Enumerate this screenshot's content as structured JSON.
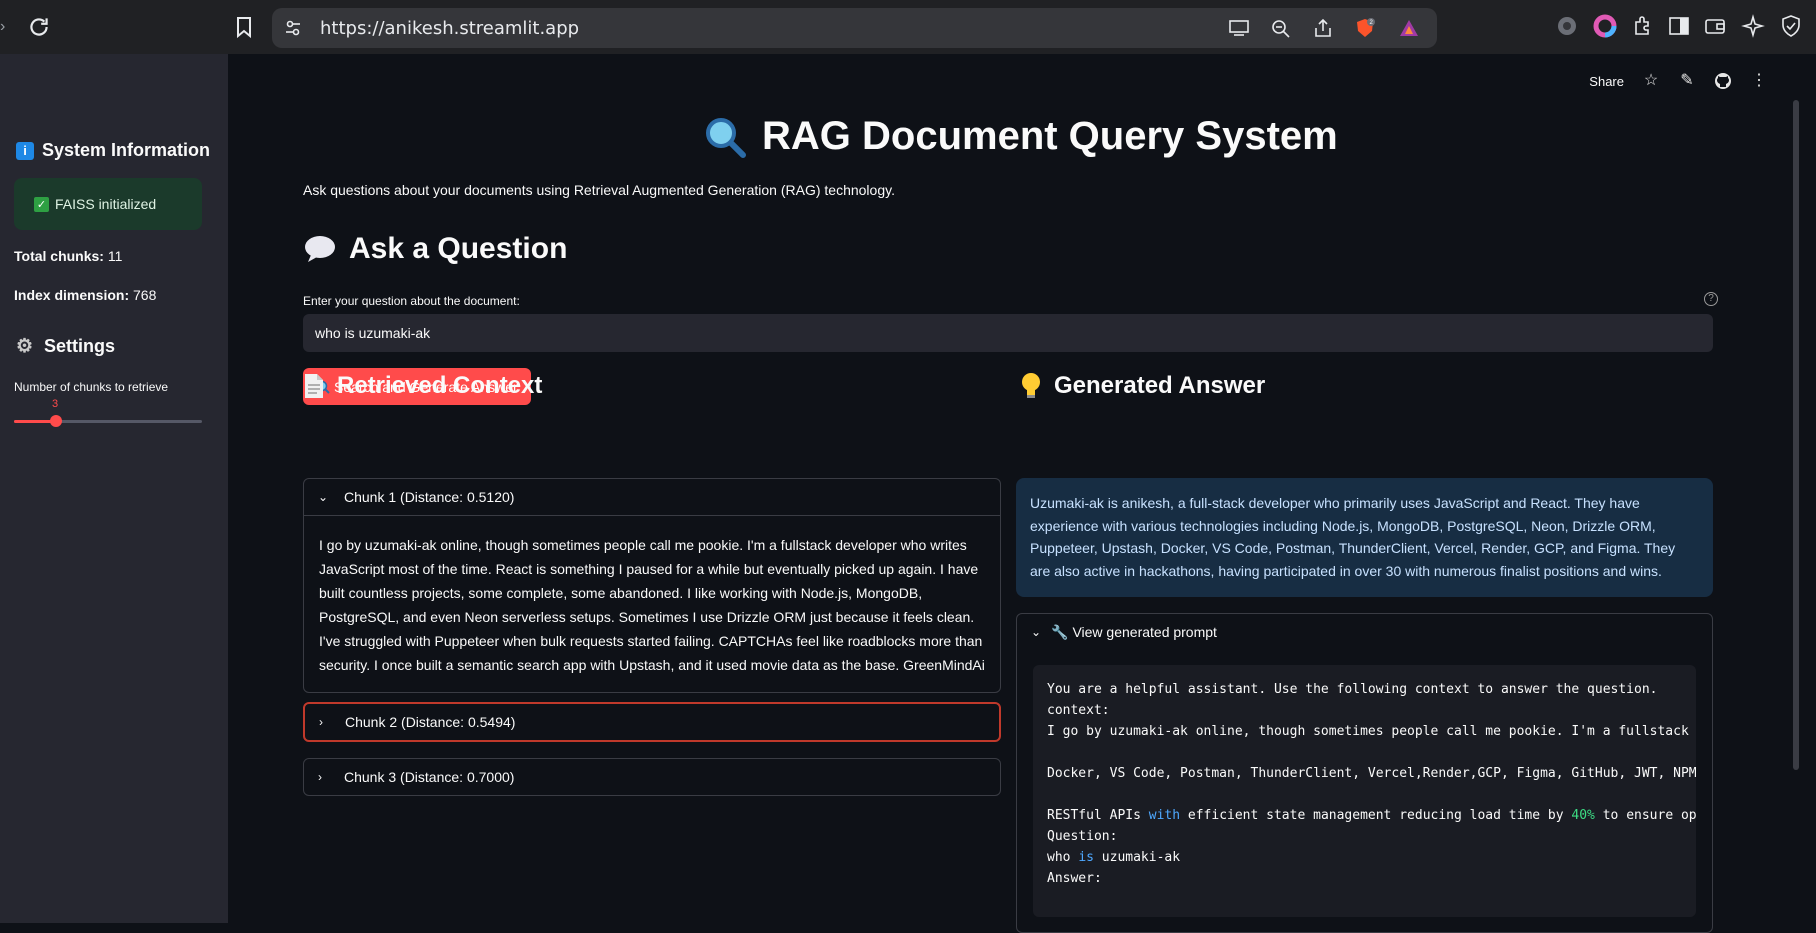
{
  "browser": {
    "url": "https://anikesh.streamlit.app",
    "brave_badge": "2"
  },
  "sidebar": {
    "system_info_title": "System Information",
    "status_text": "FAISS initialized",
    "total_chunks_label": "Total chunks:",
    "total_chunks_value": "11",
    "index_dim_label": "Index dimension:",
    "index_dim_value": "768",
    "settings_title": "Settings",
    "slider_label": "Number of chunks to retrieve",
    "slider_value": "3",
    "slider_fraction": 0.2222,
    "success_color": "#2ea043",
    "accent_color": "#ff4b4b"
  },
  "toolbar": {
    "share_label": "Share"
  },
  "header": {
    "title": "RAG Document Query System",
    "subtitle": "Ask questions about your documents using Retrieval Augmented Generation (RAG) technology."
  },
  "question": {
    "heading": "Ask a Question",
    "input_label": "Enter your question about the document:",
    "input_value": "who is uzumaki-ak",
    "button_label": "Search and Generate Answer"
  },
  "context": {
    "heading": "Retrieved Context",
    "chunks": [
      {
        "label": "Chunk 1 (Distance: 0.5120)",
        "text": "I go by uzumaki-ak online, though sometimes people call me pookie. I'm a fullstack developer who writes JavaScript most of the time. React is something I paused for a while but eventually picked up again. I have built countless projects, some complete, some abandoned. I like working with Node.js, MongoDB, PostgreSQL, and even Neon serverless setups. Sometimes I use Drizzle ORM just because it feels clean. I've struggled with Puppeteer when bulk requests started failing. CAPTCHAs feel like roadblocks more than security. I once built a semantic search app with Upstash, and it used movie data as the base. GreenMindAi"
      },
      {
        "label": "Chunk 2 (Distance: 0.5494)"
      },
      {
        "label": "Chunk 3 (Distance: 0.7000)"
      }
    ]
  },
  "answer": {
    "heading": "Generated Answer",
    "text": "Uzumaki-ak is anikesh, a full-stack developer who primarily uses JavaScript and React. They have experience with various technologies including Node.js, MongoDB, PostgreSQL, Neon, Drizzle ORM, Puppeteer, Upstash, Docker, VS Code, Postman, ThunderClient, Vercel, Render, GCP, and Figma. They are also active in hackathons, having participated in over 30 with numerous finalist positions and wins.",
    "prompt_toggle_label": "View generated prompt",
    "prompt_lines": {
      "l1": "You are a helpful assistant. Use the following context to answer the question.",
      "l2": "context:",
      "l3": "I go by uzumaki-ak online, though sometimes people call me pookie. I'm a fullstack",
      "l5": "Docker, VS Code, Postman, ThunderClient, Vercel,Render,GCP, Figma, GitHub, JWT, NPM",
      "l7a": "RESTful APIs ",
      "l7b": "with",
      "l7c": " efficient state management reducing load time by ",
      "l7d": "40%",
      "l7e": " to ensure op",
      "l8": "Question:",
      "l9a": "who ",
      "l9b": "is",
      "l9c": " uzumaki-ak",
      "l10": "Answer:"
    }
  }
}
